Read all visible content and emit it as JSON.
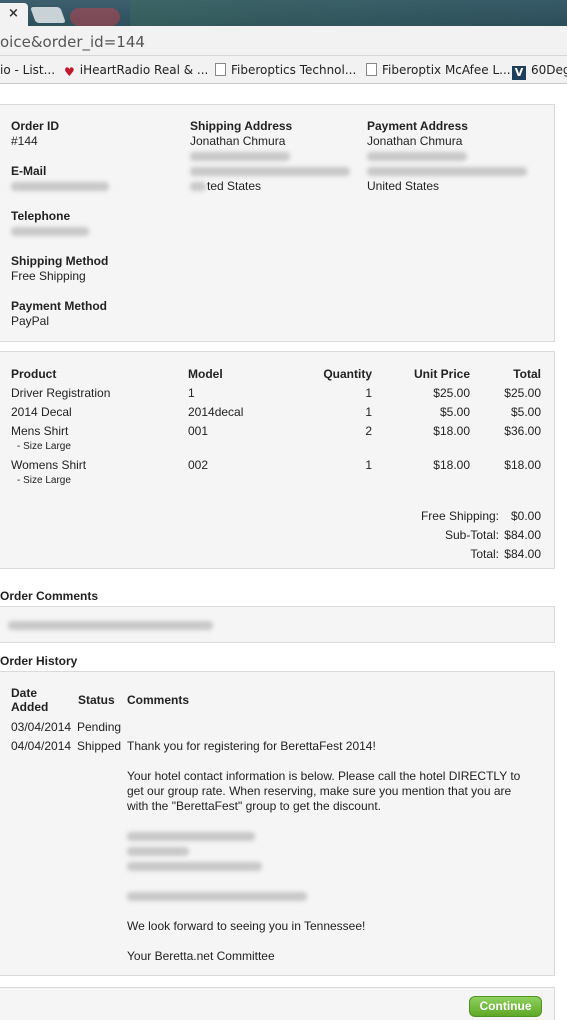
{
  "browser": {
    "tab_close": "×",
    "url": "oice&order_id=144",
    "bookmarks": [
      {
        "label": "io - List...",
        "icon": "page-icon"
      },
      {
        "label": "iHeartRadio Real & ...",
        "icon": "iheartradio-icon"
      },
      {
        "label": "Fiberoptics Technol...",
        "icon": "page-icon"
      },
      {
        "label": "Fiberoptix McAfee L...",
        "icon": "page-icon"
      },
      {
        "label": "60Deg",
        "icon": "v-logo-icon"
      }
    ]
  },
  "order": {
    "order_id_label": "Order ID",
    "order_id": "#144",
    "email_label": "E-Mail",
    "telephone_label": "Telephone",
    "shipping_method_label": "Shipping Method",
    "shipping_method": "Free Shipping",
    "payment_method_label": "Payment Method",
    "payment_method": "PayPal",
    "shipping_address_label": "Shipping Address",
    "shipping_name": "Jonathan Chmura",
    "shipping_country": "ted States",
    "payment_address_label": "Payment Address",
    "payment_name": "Jonathan Chmura",
    "payment_country": "United States"
  },
  "products": {
    "headers": {
      "product": "Product",
      "model": "Model",
      "quantity": "Quantity",
      "unit_price": "Unit Price",
      "total": "Total"
    },
    "rows": [
      {
        "product": "Driver Registration",
        "option": "",
        "model": "1",
        "quantity": "1",
        "unit_price": "$25.00",
        "total": "$25.00"
      },
      {
        "product": "2014 Decal",
        "option": "",
        "model": "2014decal",
        "quantity": "1",
        "unit_price": "$5.00",
        "total": "$5.00"
      },
      {
        "product": "Mens Shirt",
        "option": "- Size Large",
        "model": "001",
        "quantity": "2",
        "unit_price": "$18.00",
        "total": "$36.00"
      },
      {
        "product": "Womens Shirt",
        "option": "- Size Large",
        "model": "002",
        "quantity": "1",
        "unit_price": "$18.00",
        "total": "$18.00"
      }
    ],
    "totals": [
      {
        "label": "Free Shipping:",
        "value": "$0.00"
      },
      {
        "label": "Sub-Total:",
        "value": "$84.00"
      },
      {
        "label": "Total:",
        "value": "$84.00"
      }
    ]
  },
  "comments": {
    "heading": "Order Comments"
  },
  "history": {
    "heading": "Order History",
    "headers": {
      "date": "Date Added",
      "status": "Status",
      "comments": "Comments"
    },
    "rows": [
      {
        "date": "03/04/2014",
        "status": "Pending"
      },
      {
        "date": "04/04/2014",
        "status": "Shipped"
      }
    ],
    "comment_lines": {
      "thanks": "Thank you for registering for BerettaFest 2014!",
      "hotel_1": "Your hotel contact information is below. Please call the hotel DIRECTLY to",
      "hotel_2": "get our group rate. When reserving, make sure you mention that you are",
      "hotel_3": "with the \"BerettaFest\" group to get the discount.",
      "look_forward": "We look forward to seeing you in Tennessee!",
      "signature": "Your Beretta.net Committee"
    }
  },
  "actions": {
    "continue_label": "Continue",
    "accent_color": "#6fb935"
  }
}
